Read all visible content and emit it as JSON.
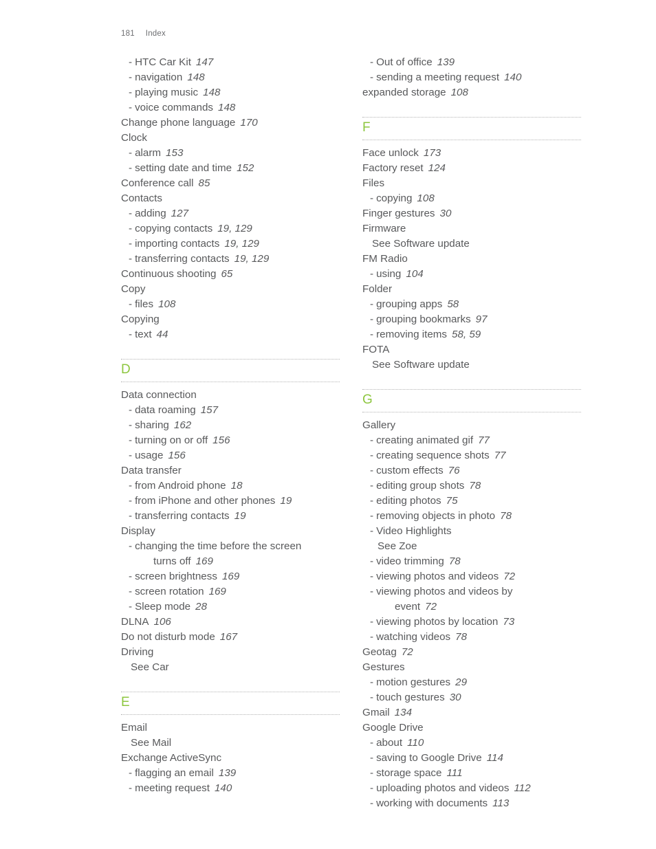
{
  "header": {
    "page_number": "181",
    "section_title": "Index"
  },
  "colors": {
    "letter_accent": "#8dc63f",
    "text": "#58595b",
    "rule": "#b3b3b3",
    "background": "#ffffff"
  },
  "columns": [
    {
      "name": "left-column",
      "groups": [
        {
          "letter": "",
          "entries": [
            {
              "level": "sub",
              "dash": "-",
              "text": "HTC Car Kit",
              "page": "147"
            },
            {
              "level": "sub",
              "dash": "-",
              "text": "navigation",
              "page": "148"
            },
            {
              "level": "sub",
              "dash": "-",
              "text": "playing music",
              "page": "148"
            },
            {
              "level": "sub",
              "dash": "-",
              "text": "voice commands",
              "page": "148"
            },
            {
              "level": "main",
              "dash": "",
              "text": "Change phone language",
              "page": "170"
            },
            {
              "level": "main",
              "dash": "",
              "text": "Clock",
              "page": ""
            },
            {
              "level": "sub",
              "dash": "-",
              "text": "alarm",
              "page": "153"
            },
            {
              "level": "sub",
              "dash": "-",
              "text": "setting date and time",
              "page": "152"
            },
            {
              "level": "main",
              "dash": "",
              "text": "Conference call",
              "page": "85"
            },
            {
              "level": "main",
              "dash": "",
              "text": "Contacts",
              "page": ""
            },
            {
              "level": "sub",
              "dash": "-",
              "text": "adding",
              "page": "127"
            },
            {
              "level": "sub",
              "dash": "-",
              "text": "copying contacts",
              "page": "19, 129"
            },
            {
              "level": "sub",
              "dash": "-",
              "text": "importing contacts",
              "page": "19, 129"
            },
            {
              "level": "sub",
              "dash": "-",
              "text": "transferring contacts",
              "page": "19, 129"
            },
            {
              "level": "main",
              "dash": "",
              "text": "Continuous shooting",
              "page": "65"
            },
            {
              "level": "main",
              "dash": "",
              "text": "Copy",
              "page": ""
            },
            {
              "level": "sub",
              "dash": "-",
              "text": "files",
              "page": "108"
            },
            {
              "level": "main",
              "dash": "",
              "text": "Copying",
              "page": ""
            },
            {
              "level": "sub",
              "dash": "-",
              "text": "text",
              "page": "44"
            }
          ]
        },
        {
          "letter": "D",
          "entries": [
            {
              "level": "main",
              "dash": "",
              "text": "Data connection",
              "page": ""
            },
            {
              "level": "sub",
              "dash": "-",
              "text": "data roaming",
              "page": "157"
            },
            {
              "level": "sub",
              "dash": "-",
              "text": "sharing",
              "page": "162"
            },
            {
              "level": "sub",
              "dash": "-",
              "text": "turning on or off",
              "page": "156"
            },
            {
              "level": "sub",
              "dash": "-",
              "text": "usage",
              "page": "156"
            },
            {
              "level": "main",
              "dash": "",
              "text": "Data transfer",
              "page": ""
            },
            {
              "level": "sub",
              "dash": "-",
              "text": "from Android phone",
              "page": "18"
            },
            {
              "level": "sub",
              "dash": "-",
              "text": "from iPhone and other phones",
              "page": "19"
            },
            {
              "level": "sub",
              "dash": "-",
              "text": "transferring contacts",
              "page": "19"
            },
            {
              "level": "main",
              "dash": "",
              "text": "Display",
              "page": ""
            },
            {
              "level": "sub",
              "dash": "-",
              "text": "changing the time before the screen",
              "page": ""
            },
            {
              "level": "cont",
              "dash": "",
              "text": "turns off",
              "page": "169"
            },
            {
              "level": "sub",
              "dash": "-",
              "text": "screen brightness",
              "page": "169"
            },
            {
              "level": "sub",
              "dash": "-",
              "text": "screen rotation",
              "page": "169"
            },
            {
              "level": "sub",
              "dash": "-",
              "text": "Sleep mode",
              "page": "28"
            },
            {
              "level": "main",
              "dash": "",
              "text": "DLNA",
              "page": "106"
            },
            {
              "level": "main",
              "dash": "",
              "text": "Do not disturb mode",
              "page": "167"
            },
            {
              "level": "main",
              "dash": "",
              "text": "Driving",
              "page": ""
            },
            {
              "level": "see-main",
              "dash": "",
              "text": "See Car",
              "page": ""
            }
          ]
        },
        {
          "letter": "E",
          "entries": [
            {
              "level": "main",
              "dash": "",
              "text": "Email",
              "page": ""
            },
            {
              "level": "see-main",
              "dash": "",
              "text": "See Mail",
              "page": ""
            },
            {
              "level": "main",
              "dash": "",
              "text": "Exchange ActiveSync",
              "page": ""
            },
            {
              "level": "sub",
              "dash": "-",
              "text": "flagging an email",
              "page": "139"
            },
            {
              "level": "sub",
              "dash": "-",
              "text": "meeting request",
              "page": "140"
            }
          ]
        }
      ]
    },
    {
      "name": "right-column",
      "groups": [
        {
          "letter": "",
          "entries": [
            {
              "level": "sub",
              "dash": "-",
              "text": "Out of office",
              "page": "139"
            },
            {
              "level": "sub",
              "dash": "-",
              "text": "sending a meeting request",
              "page": "140"
            },
            {
              "level": "main",
              "dash": "",
              "text": "expanded storage",
              "page": "108"
            }
          ]
        },
        {
          "letter": "F",
          "entries": [
            {
              "level": "main",
              "dash": "",
              "text": "Face unlock",
              "page": "173"
            },
            {
              "level": "main",
              "dash": "",
              "text": "Factory reset",
              "page": "124"
            },
            {
              "level": "main",
              "dash": "",
              "text": "Files",
              "page": ""
            },
            {
              "level": "sub",
              "dash": "-",
              "text": "copying",
              "page": "108"
            },
            {
              "level": "main",
              "dash": "",
              "text": "Finger gestures",
              "page": "30"
            },
            {
              "level": "main",
              "dash": "",
              "text": "Firmware",
              "page": ""
            },
            {
              "level": "see-main",
              "dash": "",
              "text": "See Software update",
              "page": ""
            },
            {
              "level": "main",
              "dash": "",
              "text": "FM Radio",
              "page": ""
            },
            {
              "level": "sub",
              "dash": "-",
              "text": "using",
              "page": "104"
            },
            {
              "level": "main",
              "dash": "",
              "text": "Folder",
              "page": ""
            },
            {
              "level": "sub",
              "dash": "-",
              "text": "grouping apps",
              "page": "58"
            },
            {
              "level": "sub",
              "dash": "-",
              "text": "grouping bookmarks",
              "page": "97"
            },
            {
              "level": "sub",
              "dash": "-",
              "text": "removing items",
              "page": "58, 59"
            },
            {
              "level": "main",
              "dash": "",
              "text": "FOTA",
              "page": ""
            },
            {
              "level": "see-main",
              "dash": "",
              "text": "See Software update",
              "page": ""
            }
          ]
        },
        {
          "letter": "G",
          "entries": [
            {
              "level": "main",
              "dash": "",
              "text": "Gallery",
              "page": ""
            },
            {
              "level": "sub",
              "dash": "-",
              "text": "creating animated gif",
              "page": "77"
            },
            {
              "level": "sub",
              "dash": "-",
              "text": "creating sequence shots",
              "page": "77"
            },
            {
              "level": "sub",
              "dash": "-",
              "text": "custom effects",
              "page": "76"
            },
            {
              "level": "sub",
              "dash": "-",
              "text": "editing group shots",
              "page": "78"
            },
            {
              "level": "sub",
              "dash": "-",
              "text": "editing photos",
              "page": "75"
            },
            {
              "level": "sub",
              "dash": "-",
              "text": "removing objects in photo",
              "page": "78"
            },
            {
              "level": "sub",
              "dash": "-",
              "text": "Video Highlights",
              "page": ""
            },
            {
              "level": "see-sub",
              "dash": "",
              "text": "See Zoe",
              "page": ""
            },
            {
              "level": "sub",
              "dash": "-",
              "text": "video trimming",
              "page": "78"
            },
            {
              "level": "sub",
              "dash": "-",
              "text": "viewing photos and videos",
              "page": "72"
            },
            {
              "level": "sub",
              "dash": "-",
              "text": "viewing photos and videos by",
              "page": ""
            },
            {
              "level": "cont",
              "dash": "",
              "text": "event",
              "page": "72"
            },
            {
              "level": "sub",
              "dash": "-",
              "text": "viewing photos by location",
              "page": "73"
            },
            {
              "level": "sub",
              "dash": "-",
              "text": "watching videos",
              "page": "78"
            },
            {
              "level": "main",
              "dash": "",
              "text": "Geotag",
              "page": "72"
            },
            {
              "level": "main",
              "dash": "",
              "text": "Gestures",
              "page": ""
            },
            {
              "level": "sub",
              "dash": "-",
              "text": "motion gestures",
              "page": "29"
            },
            {
              "level": "sub",
              "dash": "-",
              "text": "touch gestures",
              "page": "30"
            },
            {
              "level": "main",
              "dash": "",
              "text": "Gmail",
              "page": "134"
            },
            {
              "level": "main",
              "dash": "",
              "text": "Google Drive",
              "page": ""
            },
            {
              "level": "sub",
              "dash": "-",
              "text": "about",
              "page": "110"
            },
            {
              "level": "sub",
              "dash": "-",
              "text": "saving to Google Drive",
              "page": "114"
            },
            {
              "level": "sub",
              "dash": "-",
              "text": "storage space",
              "page": "111"
            },
            {
              "level": "sub",
              "dash": "-",
              "text": "uploading photos and videos",
              "page": "112"
            },
            {
              "level": "sub",
              "dash": "-",
              "text": "working with documents",
              "page": "113"
            }
          ]
        }
      ]
    }
  ]
}
